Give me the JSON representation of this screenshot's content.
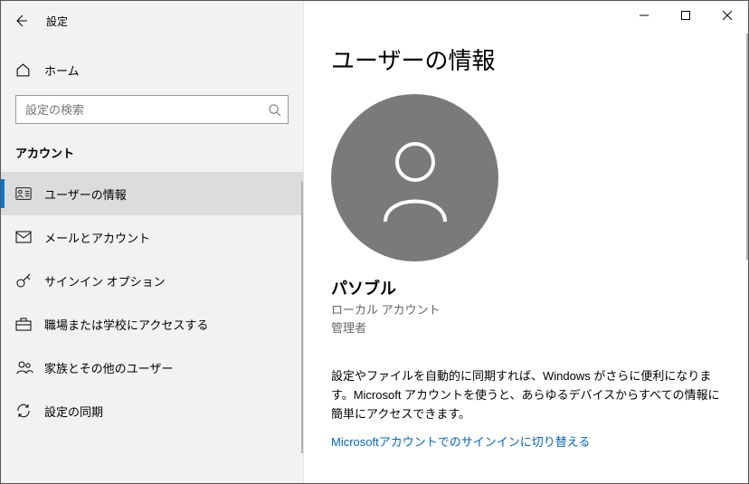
{
  "window": {
    "title": "設定"
  },
  "sidebar": {
    "home": "ホーム",
    "search_placeholder": "設定の検索",
    "category": "アカウント",
    "items": [
      {
        "label": "ユーザーの情報",
        "icon": "user-card",
        "selected": true
      },
      {
        "label": "メールとアカウント",
        "icon": "mail",
        "selected": false
      },
      {
        "label": "サインイン オプション",
        "icon": "key",
        "selected": false
      },
      {
        "label": "職場または学校にアクセスする",
        "icon": "briefcase",
        "selected": false
      },
      {
        "label": "家族とその他のユーザー",
        "icon": "people",
        "selected": false
      },
      {
        "label": "設定の同期",
        "icon": "sync",
        "selected": false
      }
    ]
  },
  "main": {
    "page_title": "ユーザーの情報",
    "user": {
      "name": "パソブル",
      "account_type": "ローカル アカウント",
      "role": "管理者"
    },
    "info_paragraph": "設定やファイルを自動的に同期すれば、Windows がさらに便利になります。Microsoft アカウントを使うと、あらゆるデバイスからすべての情報に簡単にアクセスできます。",
    "ms_link": "Microsoftアカウントでのサインインに切り替える"
  }
}
